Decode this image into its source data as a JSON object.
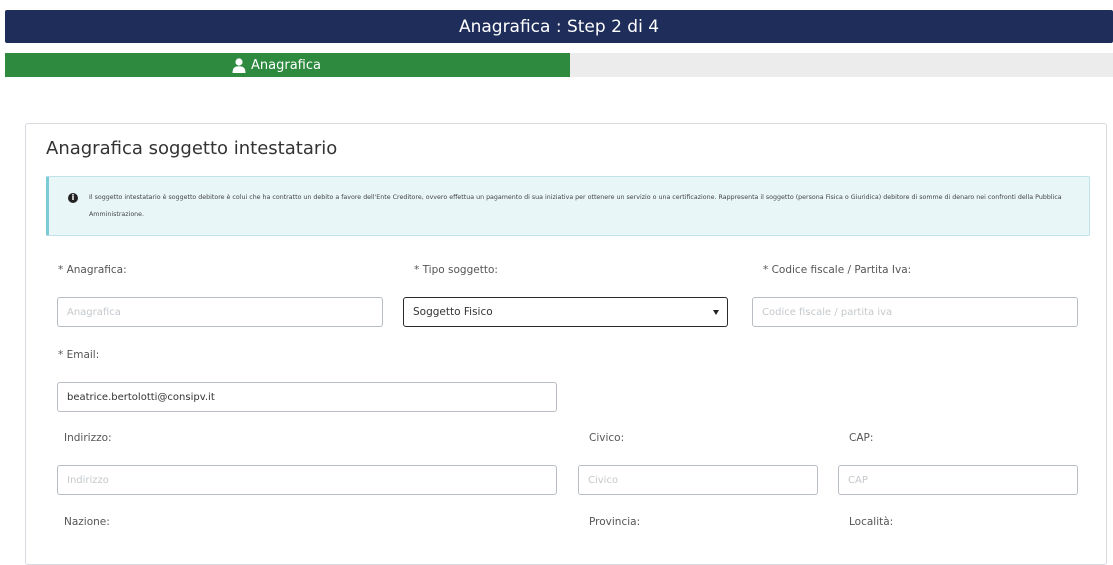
{
  "header": {
    "title": "Anagrafica : Step 2 di 4"
  },
  "progress": {
    "label": "Anagrafica",
    "icon": "user-icon",
    "fraction": 0.51,
    "fill_color": "#2d8a3f"
  },
  "card": {
    "title": "Anagrafica soggetto intestatario",
    "info_icon": "info-circle-icon",
    "info_text": "Il soggetto intestatario è soggetto debitore è colui che ha contratto un debito a favore dell'Ente Creditore, ovvero effettua un pagamento di sua iniziativa per ottenere un servizio o una certificazione. Rappresenta il soggetto (persona Fisica o Giuridica) debitore di somme di denaro nei confronti della Pubblica Amministrazione."
  },
  "form": {
    "anagrafica": {
      "label": "* Anagrafica:",
      "placeholder": "Anagrafica",
      "value": ""
    },
    "tipo_soggetto": {
      "label": "* Tipo soggetto:",
      "value": "Soggetto Fisico"
    },
    "codice_fiscale": {
      "label": "* Codice fiscale / Partita Iva:",
      "placeholder": "Codice fiscale / partita iva",
      "value": ""
    },
    "email": {
      "label": "* Email:",
      "value": "beatrice.bertolotti@consipv.it"
    },
    "indirizzo": {
      "label": "Indirizzo:",
      "placeholder": "Indirizzo",
      "value": ""
    },
    "civico": {
      "label": "Civico:",
      "placeholder": "Civico",
      "value": ""
    },
    "cap": {
      "label": "CAP:",
      "placeholder": "CAP",
      "value": ""
    },
    "nazione": {
      "label": "Nazione:"
    },
    "provincia": {
      "label": "Provincia:"
    },
    "localita": {
      "label": "Località:"
    }
  },
  "colors": {
    "header_bg": "#1f2d5a",
    "progress_bg": "#ececec",
    "info_bg": "#e8f6f8"
  }
}
